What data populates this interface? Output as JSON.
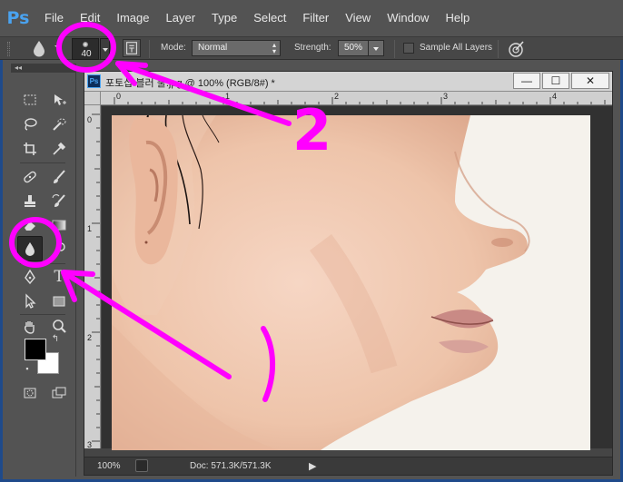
{
  "app": {
    "logo": "Ps",
    "menu": [
      "File",
      "Edit",
      "Image",
      "Layer",
      "Type",
      "Select",
      "Filter",
      "View",
      "Window",
      "Help"
    ]
  },
  "options": {
    "brush_size": "40",
    "mode_label": "Mode:",
    "mode_value": "Normal",
    "strength_label": "Strength:",
    "strength_value": "50%",
    "sample_all_layers_label": "Sample All Layers"
  },
  "toolbar": {
    "header": "◂◂",
    "active_tool": "blur-tool",
    "foreground_color": "#000000",
    "background_color": "#ffffff"
  },
  "document": {
    "badge": "Ps",
    "title": "포토샵 블러 툴.jpg @ 100% (RGB/8#) *",
    "window_buttons": [
      "—",
      "☐",
      "✕"
    ],
    "ruler_h": [
      "0",
      "1",
      "2",
      "3",
      "4"
    ],
    "ruler_v": [
      "0",
      "1",
      "2",
      "3"
    ]
  },
  "status": {
    "zoom": "100%",
    "doc_size": "Doc: 571.3K/571.3K"
  },
  "annotations": {
    "label_2": "2",
    "color": "#ff00ff"
  }
}
